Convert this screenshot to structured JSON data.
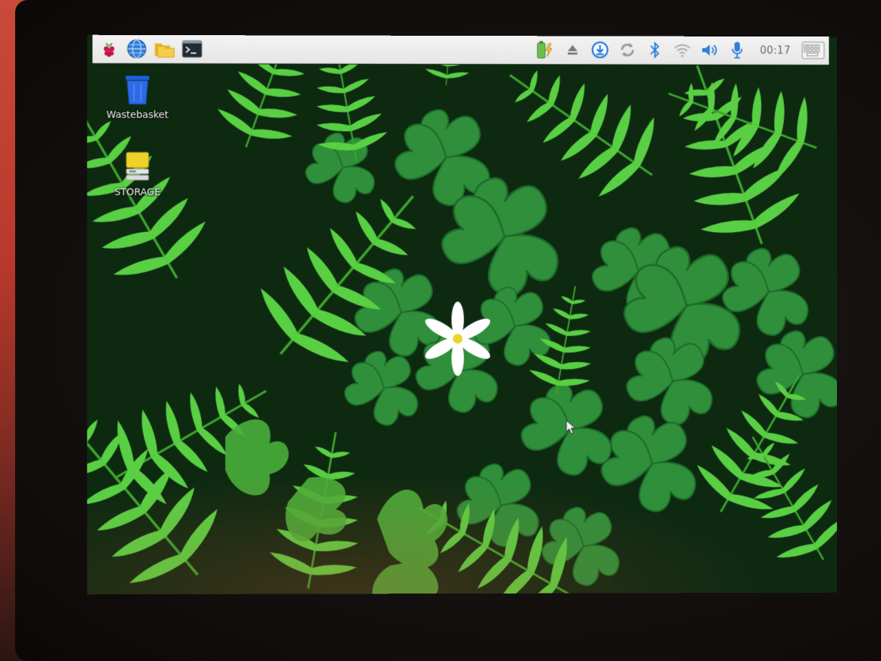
{
  "panel": {
    "launchers": [
      {
        "name": "raspberry-menu",
        "icon": "raspberry-icon"
      },
      {
        "name": "web-browser",
        "icon": "globe-icon"
      },
      {
        "name": "file-manager",
        "icon": "folder-icon"
      },
      {
        "name": "terminal",
        "icon": "terminal-icon"
      }
    ],
    "tray_icons": [
      "battery-charging-icon",
      "eject-icon",
      "download-icon",
      "sync-icon",
      "bluetooth-icon",
      "wifi-icon",
      "volume-icon",
      "microphone-icon"
    ],
    "clock": "00:17",
    "keyboard_icon": "virtual-keyboard-icon"
  },
  "desktop": {
    "icons": [
      {
        "label": "Wastebasket",
        "icon": "trash-icon"
      },
      {
        "label": "STORAGE",
        "icon": "drive-icon"
      }
    ]
  },
  "colors": {
    "panel_bg": "#ececec",
    "accent_blue": "#2f7fd8",
    "wallpaper_fern": "#4fc23a",
    "wallpaper_clover": "#2f8f3a"
  }
}
